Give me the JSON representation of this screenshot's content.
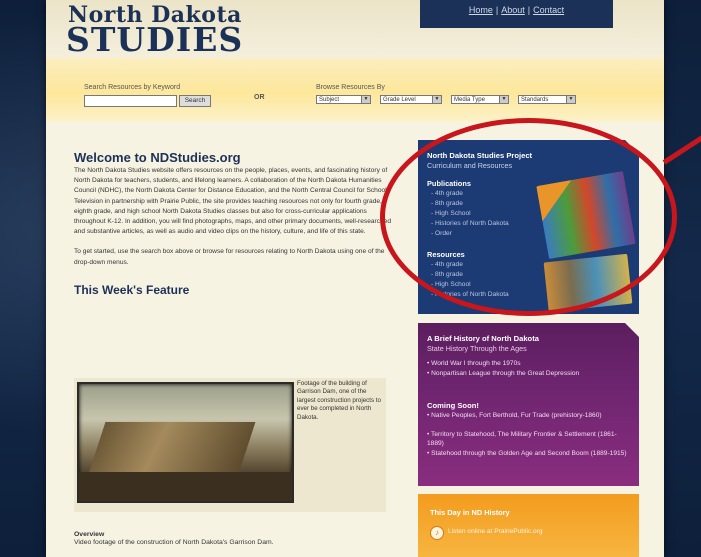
{
  "header": {
    "logo_line1": "North Dakota",
    "logo_line2": "STUDIES",
    "nav": [
      "Home",
      "About",
      "Contact"
    ],
    "nav_separator": "|"
  },
  "search": {
    "keyword_label": "Search Resources by Keyword",
    "keyword_value": "",
    "search_button": "Search",
    "or_label": "OR",
    "browse_label": "Browse Resources By",
    "selects": [
      "Subject",
      "Grade Level",
      "Media Type",
      "Standards"
    ]
  },
  "welcome": {
    "title": "Welcome to NDStudies.org",
    "paragraph1": "The North Dakota Studies website offers resources on the people, places, events, and fascinating history of North Dakota for teachers, students, and lifelong learners. A collaboration of the North Dakota Humanities Council (NDHC), the North Dakota Center for Distance Education, and the North Central Council for School Television in partnership with Prairie Public, the site provides teaching resources not only for fourth grade, eighth grade, and high school North Dakota Studies classes but also for cross-curricular applications throughout K-12. In addition, you will find photographs, maps, and other primary documents, well-researched and substantive articles, as well as audio and video clips on the history, culture, and life of this state.",
    "paragraph2": "To get started, use the search box above or browse for resources relating to North Dakota using one of the drop-down menus."
  },
  "feature": {
    "title": "This Week's Feature",
    "caption": "Footage of the building of Garrison Dam, one of the largest construction projects to ever be completed in North Dakota.",
    "overview_title": "Overview",
    "overview_text": "Video footage of the construction of North Dakota's Garrison Dam."
  },
  "project_panel": {
    "title": "North Dakota Studies Project",
    "subtitle": "Curriculum and Resources",
    "publications_heading": "Publications",
    "publications": [
      "4th grade",
      "8th grade",
      "High School",
      "Histories of North Dakota",
      "Order"
    ],
    "resources_heading": "Resources",
    "resources": [
      "4th grade",
      "8th grade",
      "High School",
      "Histories of North Dakota"
    ]
  },
  "history_panel": {
    "title": "A Brief History of North Dakota",
    "subtitle": "State History Through the Ages",
    "items": [
      "World War I through the 1970s",
      "Nonpartisan League through the Great Depression"
    ],
    "coming_heading": "Coming Soon!",
    "coming_items": [
      "Native Peoples, Fort Berthold, Fur Trade (prehistory-1860)",
      "Territory to Statehood, The Military Frontier & Settlement (1861-1889)",
      "Statehood through the Golden Age and Second Boom (1889-1915)"
    ]
  },
  "today_panel": {
    "title": "This Day in ND History",
    "link_text": "Listen online at PrairiePublic.org"
  },
  "colors": {
    "navy": "#1c3157",
    "panel_blue": "#1c3a73",
    "panel_purple": "#6e2570",
    "panel_orange": "#f39c1e",
    "annotation_red": "#c7161c"
  }
}
